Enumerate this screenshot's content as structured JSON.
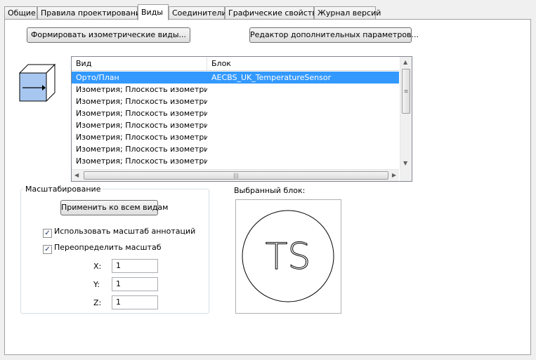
{
  "tabs": [
    {
      "label": "Общие"
    },
    {
      "label": "Правила проектирования"
    },
    {
      "label": "Виды"
    },
    {
      "label": "Соединители"
    },
    {
      "label": "Графические свойства"
    },
    {
      "label": "Журнал версий"
    }
  ],
  "buttons": {
    "generate_iso": "Формировать изометрические виды...",
    "extra_params": "Редактор дополнительных параметров...",
    "apply_all": "Применить ко всем видам"
  },
  "list": {
    "headers": [
      "Вид",
      "Блок"
    ],
    "rows": [
      {
        "view": "Орто/План",
        "block": "AECBS_UK_TemperatureSensor",
        "selected": true
      },
      {
        "view": "Изометрия; Плоскость изометрии...",
        "block": ""
      },
      {
        "view": "Изометрия; Плоскость изометрии...",
        "block": ""
      },
      {
        "view": "Изометрия; Плоскость изометрии...",
        "block": ""
      },
      {
        "view": "Изометрия; Плоскость изометрии...",
        "block": ""
      },
      {
        "view": "Изометрия; Плоскость изометрии...",
        "block": ""
      },
      {
        "view": "Изометрия; Плоскость изометрии...",
        "block": ""
      },
      {
        "view": "Изометрия; Плоскость изометрии...",
        "block": ""
      }
    ]
  },
  "scaling": {
    "title": "Масштабирование",
    "use_annotation_scale": {
      "label": "Использовать масштаб аннотаций",
      "checked": true
    },
    "override_scale": {
      "label": "Переопределить масштаб",
      "checked": true
    },
    "x": {
      "label": "X:",
      "value": "1"
    },
    "y": {
      "label": "Y:",
      "value": "1"
    },
    "z": {
      "label": "Z:",
      "value": "1"
    }
  },
  "preview": {
    "title": "Выбранный блок:",
    "symbol_text": "TS"
  },
  "icons": {
    "cube": "view-direction-cube-icon",
    "checkmark": "✓"
  }
}
